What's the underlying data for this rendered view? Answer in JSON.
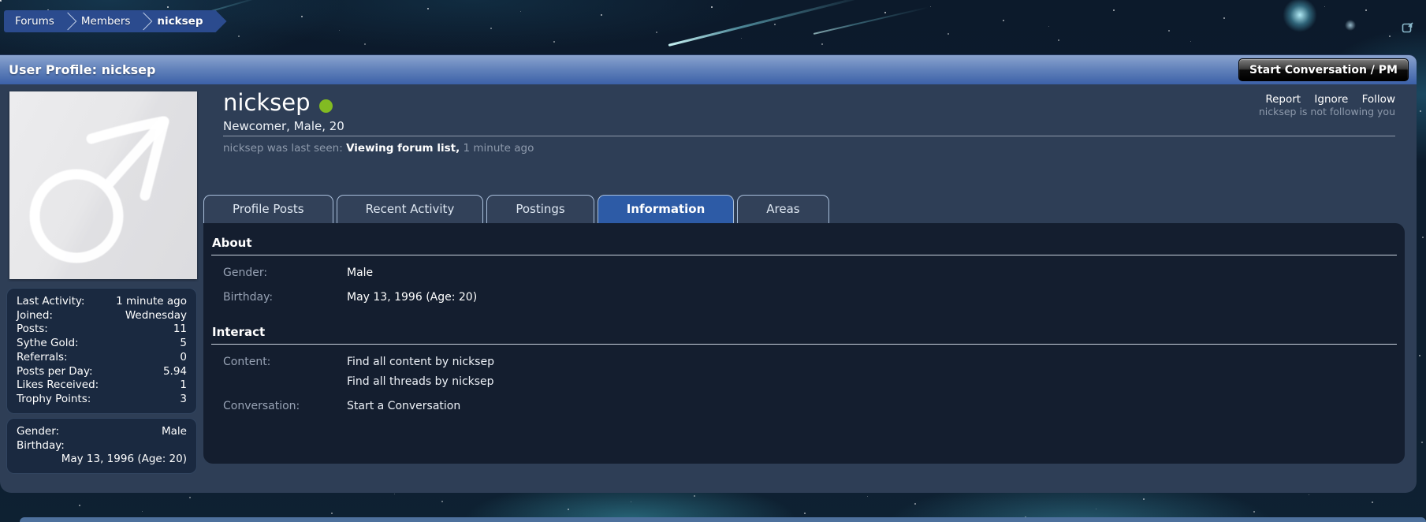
{
  "colors": {
    "breadcrumb_blue": "#2b4b8e",
    "header_top": "#8aa3ce",
    "header_bottom": "#3c61a8",
    "content_navy": "#2e3e56",
    "panel_dark": "#141e2f",
    "box_bg": "#1a2940",
    "active_tab": "#2d5ba6",
    "footer_blue": "#4e719d",
    "online_green": "#82bb22",
    "label_gray": "#97a2b4",
    "muted_gray": "#8e9aac"
  },
  "icons": {
    "popout": "popout-icon",
    "avatar": "male-symbol-icon",
    "online_status": "online-dot"
  },
  "breadcrumb": {
    "items": [
      "Forums",
      "Members",
      "nicksep"
    ]
  },
  "header": {
    "title": "User Profile: nicksep",
    "start_conversation_button": "Start Conversation / PM"
  },
  "profile": {
    "username": "nicksep",
    "online_status": "online",
    "user_title": "Newcomer, Male, 20",
    "last_seen_prefix": "nicksep was last seen:",
    "last_seen_activity": "Viewing forum list,",
    "last_seen_time": "1 minute ago",
    "actions": [
      {
        "label": "Report"
      },
      {
        "label": "Ignore"
      },
      {
        "label": "Follow"
      }
    ],
    "follow_note": "nicksep is not following you"
  },
  "sidebar": {
    "stats": [
      {
        "label": "Last Activity:",
        "value": "1 minute ago"
      },
      {
        "label": "Joined:",
        "value": "Wednesday"
      },
      {
        "label": "Posts:",
        "value": "11"
      },
      {
        "label": "Sythe Gold:",
        "value": "5"
      },
      {
        "label": "Referrals:",
        "value": "0"
      },
      {
        "label": "Posts per Day:",
        "value": "5.94"
      },
      {
        "label": "Likes Received:",
        "value": "1"
      },
      {
        "label": "Trophy Points:",
        "value": "3"
      }
    ],
    "details": {
      "gender_label": "Gender:",
      "gender_value": "Male",
      "birthday_label": "Birthday:",
      "birthday_value": "May 13, 1996 (Age: 20)"
    }
  },
  "tabs": [
    {
      "label": "Profile Posts",
      "active": false
    },
    {
      "label": "Recent Activity",
      "active": false
    },
    {
      "label": "Postings",
      "active": false
    },
    {
      "label": "Information",
      "active": true
    },
    {
      "label": "Areas",
      "active": false
    }
  ],
  "information": {
    "about": {
      "title": "About",
      "rows": [
        {
          "label": "Gender:",
          "value": "Male"
        },
        {
          "label": "Birthday:",
          "value": "May 13, 1996 (Age: 20)"
        }
      ]
    },
    "interact": {
      "title": "Interact",
      "rows": [
        {
          "label": "Content:",
          "links": [
            "Find all content by nicksep",
            "Find all threads by nicksep"
          ]
        },
        {
          "label": "Conversation:",
          "links": [
            "Start a Conversation"
          ]
        }
      ]
    }
  }
}
